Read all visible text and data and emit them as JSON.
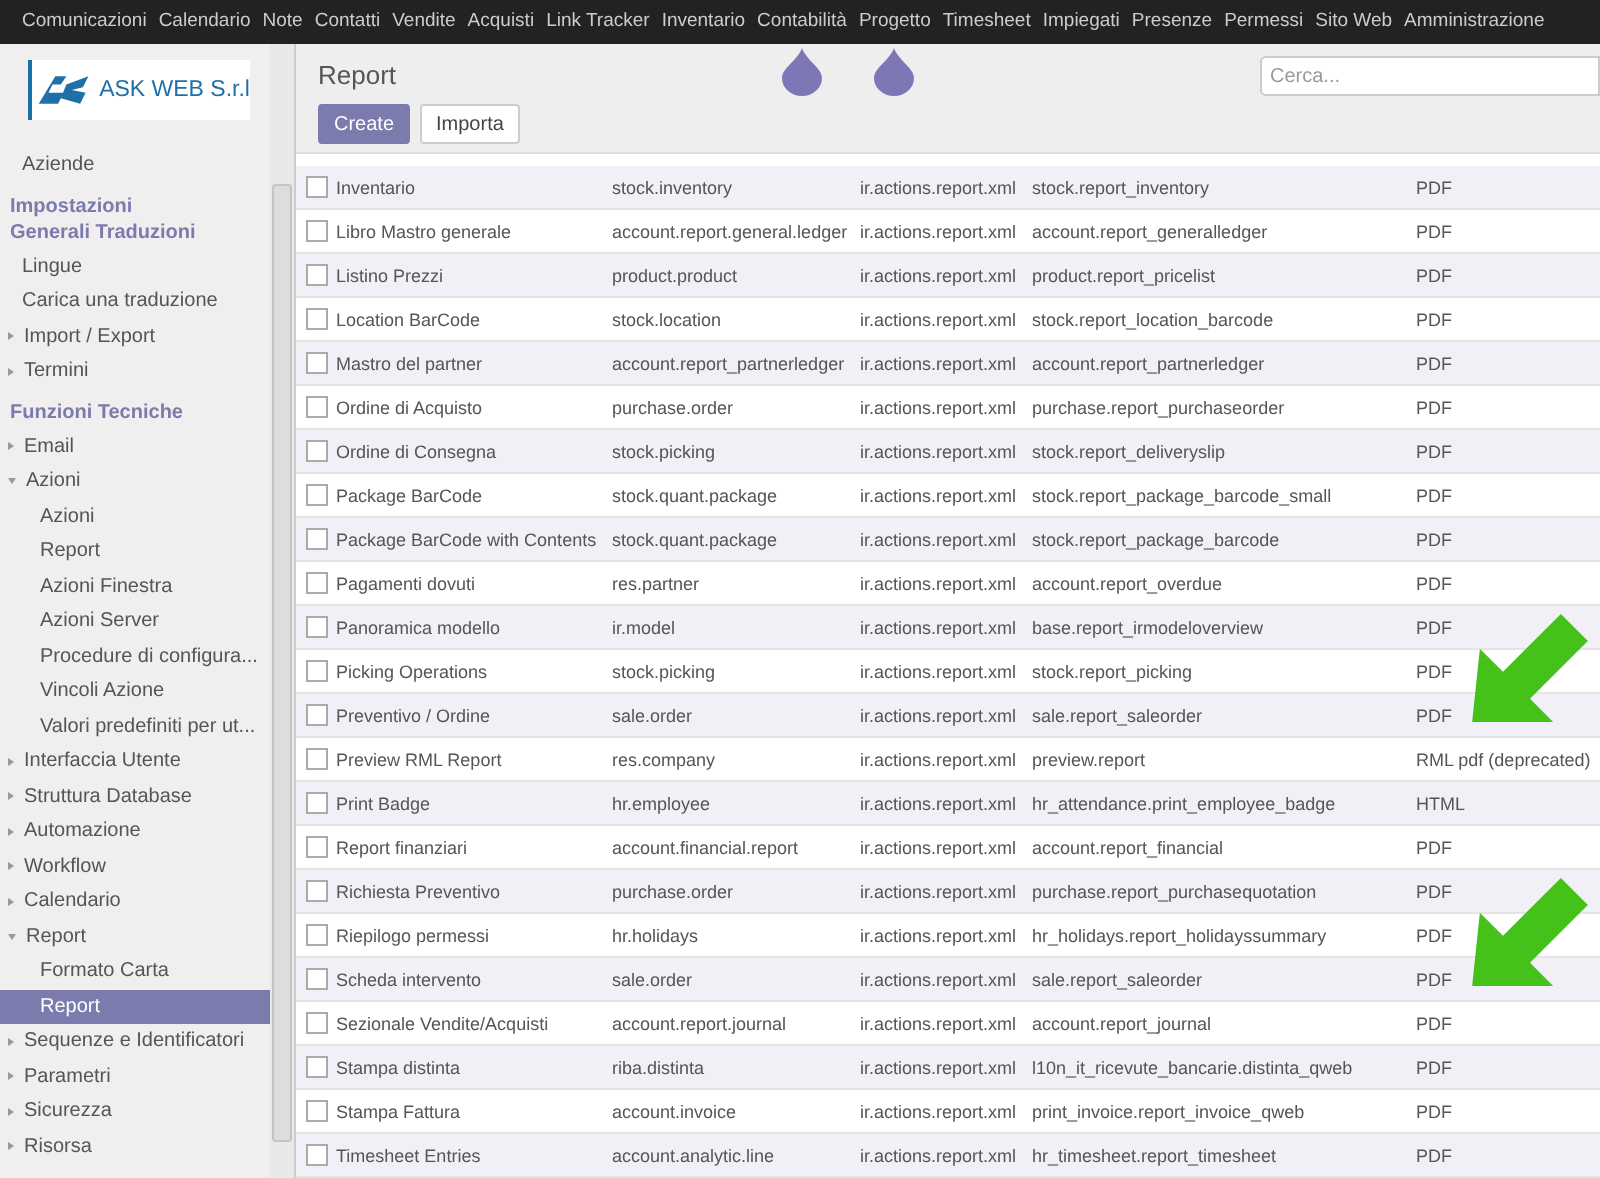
{
  "top_menu": [
    "Comunicazioni",
    "Calendario",
    "Note",
    "Contatti",
    "Vendite",
    "Acquisti",
    "Link Tracker",
    "Inventario",
    "Contabilità",
    "Progetto",
    "Timesheet",
    "Impiegati",
    "Presenze",
    "Permessi",
    "Sito Web",
    "Amministrazione"
  ],
  "logo": {
    "text": "ASK WEB S.r.l"
  },
  "sidebar": {
    "items": [
      {
        "kind": "item",
        "label": "Aziende",
        "selected": false
      },
      {
        "kind": "header",
        "label": "Impostazioni Generali Traduzioni"
      },
      {
        "kind": "item",
        "label": "Lingue",
        "selected": false
      },
      {
        "kind": "item",
        "label": "Carica una traduzione",
        "selected": false
      },
      {
        "kind": "group",
        "label": "Import / Export",
        "expanded": false
      },
      {
        "kind": "group",
        "label": "Termini",
        "expanded": false
      },
      {
        "kind": "header",
        "label": "Funzioni Tecniche"
      },
      {
        "kind": "group",
        "label": "Email",
        "expanded": false
      },
      {
        "kind": "group",
        "label": "Azioni",
        "expanded": true,
        "children": [
          {
            "kind": "item",
            "label": "Azioni",
            "selected": false
          },
          {
            "kind": "item",
            "label": "Report",
            "selected": false
          },
          {
            "kind": "item",
            "label": "Azioni Finestra",
            "selected": false
          },
          {
            "kind": "item",
            "label": "Azioni Server",
            "selected": false
          },
          {
            "kind": "item",
            "label": "Procedure di configura...",
            "selected": false
          },
          {
            "kind": "item",
            "label": "Vincoli Azione",
            "selected": false
          },
          {
            "kind": "item",
            "label": "Valori predefiniti per ut...",
            "selected": false
          }
        ]
      },
      {
        "kind": "group",
        "label": "Interfaccia Utente",
        "expanded": false
      },
      {
        "kind": "group",
        "label": "Struttura Database",
        "expanded": false
      },
      {
        "kind": "group",
        "label": "Automazione",
        "expanded": false
      },
      {
        "kind": "group",
        "label": "Workflow",
        "expanded": false
      },
      {
        "kind": "group",
        "label": "Calendario",
        "expanded": false
      },
      {
        "kind": "group",
        "label": "Report",
        "expanded": true,
        "children": [
          {
            "kind": "item",
            "label": "Formato Carta",
            "selected": false
          },
          {
            "kind": "item",
            "label": "Report",
            "selected": true
          }
        ]
      },
      {
        "kind": "group",
        "label": "Sequenze e Identificatori",
        "expanded": false
      },
      {
        "kind": "group",
        "label": "Parametri",
        "expanded": false
      },
      {
        "kind": "group",
        "label": "Sicurezza",
        "expanded": false
      },
      {
        "kind": "group",
        "label": "Risorsa",
        "expanded": false
      }
    ]
  },
  "header": {
    "title": "Report",
    "buttons": [
      {
        "label": "Create",
        "kind": "primary"
      },
      {
        "label": "Importa",
        "kind": "secondary"
      }
    ],
    "search": {
      "placeholder": "Cerca..."
    }
  },
  "table": {
    "rows": [
      {
        "checked": false,
        "cells": [
          "Inventario",
          "stock.inventory",
          "ir.actions.report.xml",
          "stock.report_inventory",
          "PDF"
        ]
      },
      {
        "checked": false,
        "cells": [
          "Libro Mastro generale",
          "account.report.general.ledger",
          "ir.actions.report.xml",
          "account.report_generalledger",
          "PDF"
        ]
      },
      {
        "checked": false,
        "cells": [
          "Listino Prezzi",
          "product.product",
          "ir.actions.report.xml",
          "product.report_pricelist",
          "PDF"
        ]
      },
      {
        "checked": false,
        "cells": [
          "Location BarCode",
          "stock.location",
          "ir.actions.report.xml",
          "stock.report_location_barcode",
          "PDF"
        ]
      },
      {
        "checked": false,
        "cells": [
          "Mastro del partner",
          "account.report_partnerledger",
          "ir.actions.report.xml",
          "account.report_partnerledger",
          "PDF"
        ]
      },
      {
        "checked": false,
        "cells": [
          "Ordine di Acquisto",
          "purchase.order",
          "ir.actions.report.xml",
          "purchase.report_purchaseorder",
          "PDF"
        ]
      },
      {
        "checked": false,
        "cells": [
          "Ordine di Consegna",
          "stock.picking",
          "ir.actions.report.xml",
          "stock.report_deliveryslip",
          "PDF"
        ]
      },
      {
        "checked": false,
        "cells": [
          "Package BarCode",
          "stock.quant.package",
          "ir.actions.report.xml",
          "stock.report_package_barcode_small",
          "PDF"
        ]
      },
      {
        "checked": false,
        "cells": [
          "Package BarCode with Contents",
          "stock.quant.package",
          "ir.actions.report.xml",
          "stock.report_package_barcode",
          "PDF"
        ]
      },
      {
        "checked": false,
        "cells": [
          "Pagamenti dovuti",
          "res.partner",
          "ir.actions.report.xml",
          "account.report_overdue",
          "PDF"
        ]
      },
      {
        "checked": false,
        "cells": [
          "Panoramica modello",
          "ir.model",
          "ir.actions.report.xml",
          "base.report_irmodeloverview",
          "PDF"
        ]
      },
      {
        "checked": false,
        "cells": [
          "Picking Operations",
          "stock.picking",
          "ir.actions.report.xml",
          "stock.report_picking",
          "PDF"
        ]
      },
      {
        "checked": false,
        "cells": [
          "Preventivo / Ordine",
          "sale.order",
          "ir.actions.report.xml",
          "sale.report_saleorder",
          "PDF"
        ],
        "arrow": true
      },
      {
        "checked": false,
        "cells": [
          "Preview RML Report",
          "res.company",
          "ir.actions.report.xml",
          "preview.report",
          "RML pdf (deprecated)"
        ]
      },
      {
        "checked": false,
        "cells": [
          "Print Badge",
          "hr.employee",
          "ir.actions.report.xml",
          "hr_attendance.print_employee_badge",
          "HTML"
        ]
      },
      {
        "checked": false,
        "cells": [
          "Report finanziari",
          "account.financial.report",
          "ir.actions.report.xml",
          "account.report_financial",
          "PDF"
        ]
      },
      {
        "checked": false,
        "cells": [
          "Richiesta Preventivo",
          "purchase.order",
          "ir.actions.report.xml",
          "purchase.report_purchasequotation",
          "PDF"
        ]
      },
      {
        "checked": false,
        "cells": [
          "Riepilogo permessi",
          "hr.holidays",
          "ir.actions.report.xml",
          "hr_holidays.report_holidayssummary",
          "PDF"
        ]
      },
      {
        "checked": false,
        "cells": [
          "Scheda intervento",
          "sale.order",
          "ir.actions.report.xml",
          "sale.report_saleorder",
          "PDF"
        ],
        "arrow": true
      },
      {
        "checked": false,
        "cells": [
          "Sezionale Vendite/Acquisti",
          "account.report.journal",
          "ir.actions.report.xml",
          "account.report_journal",
          "PDF"
        ]
      },
      {
        "checked": false,
        "cells": [
          "Stampa distinta",
          "riba.distinta",
          "ir.actions.report.xml",
          "l10n_it_ricevute_bancarie.distinta_qweb",
          "PDF"
        ]
      },
      {
        "checked": false,
        "cells": [
          "Stampa Fattura",
          "account.invoice",
          "ir.actions.report.xml",
          "print_invoice.report_invoice_qweb",
          "PDF"
        ]
      },
      {
        "checked": false,
        "cells": [
          "Timesheet Entries",
          "account.analytic.line",
          "ir.actions.report.xml",
          "hr_timesheet.report_timesheet",
          "PDF"
        ]
      }
    ]
  }
}
